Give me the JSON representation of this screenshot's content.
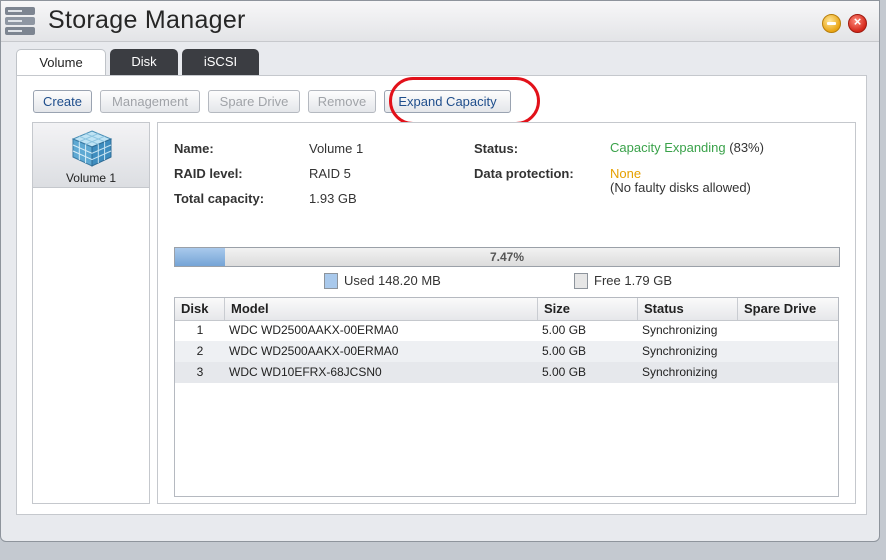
{
  "window": {
    "title": "Storage Manager"
  },
  "tabs": [
    {
      "label": "Volume",
      "active": true
    },
    {
      "label": "Disk",
      "active": false
    },
    {
      "label": "iSCSI",
      "active": false
    }
  ],
  "toolbar": {
    "create": "Create",
    "management": "Management",
    "spare_drive": "Spare Drive",
    "remove": "Remove",
    "expand_capacity": "Expand Capacity"
  },
  "volumes": [
    {
      "label": "Volume 1",
      "icon": "cube-icon"
    }
  ],
  "details": {
    "name_label": "Name:",
    "name_value": "Volume 1",
    "raid_label": "RAID level:",
    "raid_value": "RAID 5",
    "capacity_label": "Total capacity:",
    "capacity_value": "1.93 GB",
    "status_label": "Status:",
    "status_value": "Capacity Expanding",
    "status_percent": "(83%)",
    "protection_label": "Data protection:",
    "protection_value": "None",
    "protection_note": "(No faulty disks allowed)"
  },
  "usage": {
    "percent_text": "7.47%",
    "fraction": 0.0747,
    "used_label": "Used 148.20 MB",
    "free_label": "Free 1.79 GB",
    "used_color": "#a9c9ec",
    "free_color": "#e6e6e6"
  },
  "table": {
    "headers": [
      "Disk",
      "Model",
      "Size",
      "Status",
      "Spare Drive"
    ],
    "rows": [
      [
        "1",
        "WDC WD2500AAKX-00ERMA0",
        "5.00 GB",
        "Synchronizing",
        ""
      ],
      [
        "2",
        "WDC WD2500AAKX-00ERMA0",
        "5.00 GB",
        "Synchronizing",
        ""
      ],
      [
        "3",
        "WDC WD10EFRX-68JCSN0",
        "5.00 GB",
        "Synchronizing",
        ""
      ]
    ]
  },
  "colors": {
    "accent": "#1f4e8c",
    "status_green": "#3aa24a",
    "warning_orange": "#e6a000",
    "highlight_red": "#e2111a"
  }
}
